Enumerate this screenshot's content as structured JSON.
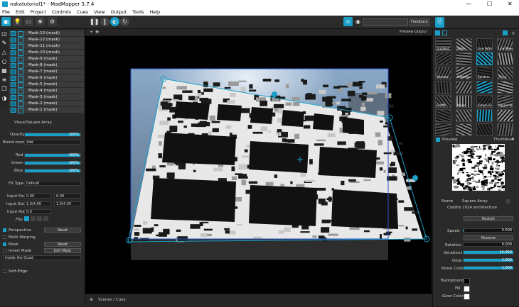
{
  "window": {
    "title": "nakatutorial1* - MadMapper 3.7.4",
    "minimize": "—",
    "maximize": "☐",
    "close": "✕"
  },
  "menu": [
    "File",
    "Edit",
    "Project",
    "Controls",
    "Cues",
    "View",
    "Output",
    "Tools",
    "Help"
  ],
  "toolbar": {
    "feedback_label": "Feedback"
  },
  "surfaces": [
    {
      "label": "Mask-13 (mask)"
    },
    {
      "label": "Mask-12 (mask)"
    },
    {
      "label": "Mask-11 (mask)"
    },
    {
      "label": "Mask-10 (mask)"
    },
    {
      "label": "Mask-9 (mask)"
    },
    {
      "label": "Mask-8 (mask)"
    },
    {
      "label": "Mask-7 (mask)"
    },
    {
      "label": "Mask-6 (mask)"
    },
    {
      "label": "Mask-5 (mask)"
    },
    {
      "label": "Mask-4 (mask)"
    },
    {
      "label": "Mask-3 (mask)"
    },
    {
      "label": "Mask-2 (mask)"
    },
    {
      "label": "Mask-1 (mask)"
    }
  ],
  "props": {
    "visual_label": "Visual",
    "visual_value": "Square Array",
    "opacity_label": "Opacity",
    "opacity_value": "100%",
    "opacity_level": 1.0,
    "blend_label": "Blend mode",
    "blend_value": "Add",
    "red_label": "Red",
    "red_value": "100%",
    "green_label": "Green",
    "green_value": "100%",
    "blue_label": "Blue",
    "blue_value": "100%",
    "fx_label": "FX Type",
    "fx_value": "Default",
    "input_pos_label": "Input Pos",
    "input_pos_x": "0.00",
    "input_pos_y": "0.00",
    "input_size_label": "Input Size",
    "input_size_x": "1.0(4.00",
    "input_size_y": "1.0(4.00",
    "input_rot_label": "Input Rot",
    "input_rot_value": "0.0",
    "flip_label": "Flip",
    "perspective_label": "Perspective",
    "reset_label": "Reset",
    "multi_warping_label": "Multi Warping",
    "mask_label": "Mask",
    "invert_mask_label": "Invert Mask",
    "edit_mask_label": "Edit Mask",
    "inside_quad_label": "Inside the Quad",
    "soft_edge_label": "Soft-Edge"
  },
  "stage": {
    "preview_output_label": "Preview Output",
    "scenes_label": "Scenes / Cues"
  },
  "library": {
    "thumbs": [
      "Gradient",
      "Strob",
      "Line Patterns",
      "Line Waves",
      "",
      "",
      "",
      "",
      "Abstract",
      "Particles",
      "Random",
      "Tiling",
      "",
      "",
      "",
      "",
      "Graffiti",
      "Noise",
      "Simple Sliders",
      "Square Array",
      "",
      "",
      "",
      "",
      "",
      "",
      "",
      ""
    ]
  },
  "inspector": {
    "preview_label": "Preview",
    "thumbnail_label": "Thumbnail",
    "name_label": "Name",
    "name_value": "Square Array",
    "credits_label": "Credits",
    "credits_value": "1024 architecture",
    "restart_label": "Restart",
    "speed_label": "Speed",
    "speed_value": "0.500",
    "speed_level": 0.02,
    "reverse_label": "Reverse",
    "rotation_label": "Rotation",
    "rotation_value": "0.000",
    "rotation_level": 0.0,
    "iterations_label": "Iterations",
    "iterations_value": "14.990",
    "iterations_level": 1.0,
    "glow_label": "Glow",
    "glow_value": "1.000",
    "glow_level": 1.0,
    "noise_color_label": "Noise Color",
    "noise_color_value": "1.000",
    "noise_color_level": 1.0,
    "background_label": "Background",
    "fill_label": "Fill",
    "glow_color_label": "Glow Color"
  },
  "colors": {
    "accent": "#1aa0c8",
    "panel": "#2a2a2a",
    "row": "#3b3b3b"
  }
}
